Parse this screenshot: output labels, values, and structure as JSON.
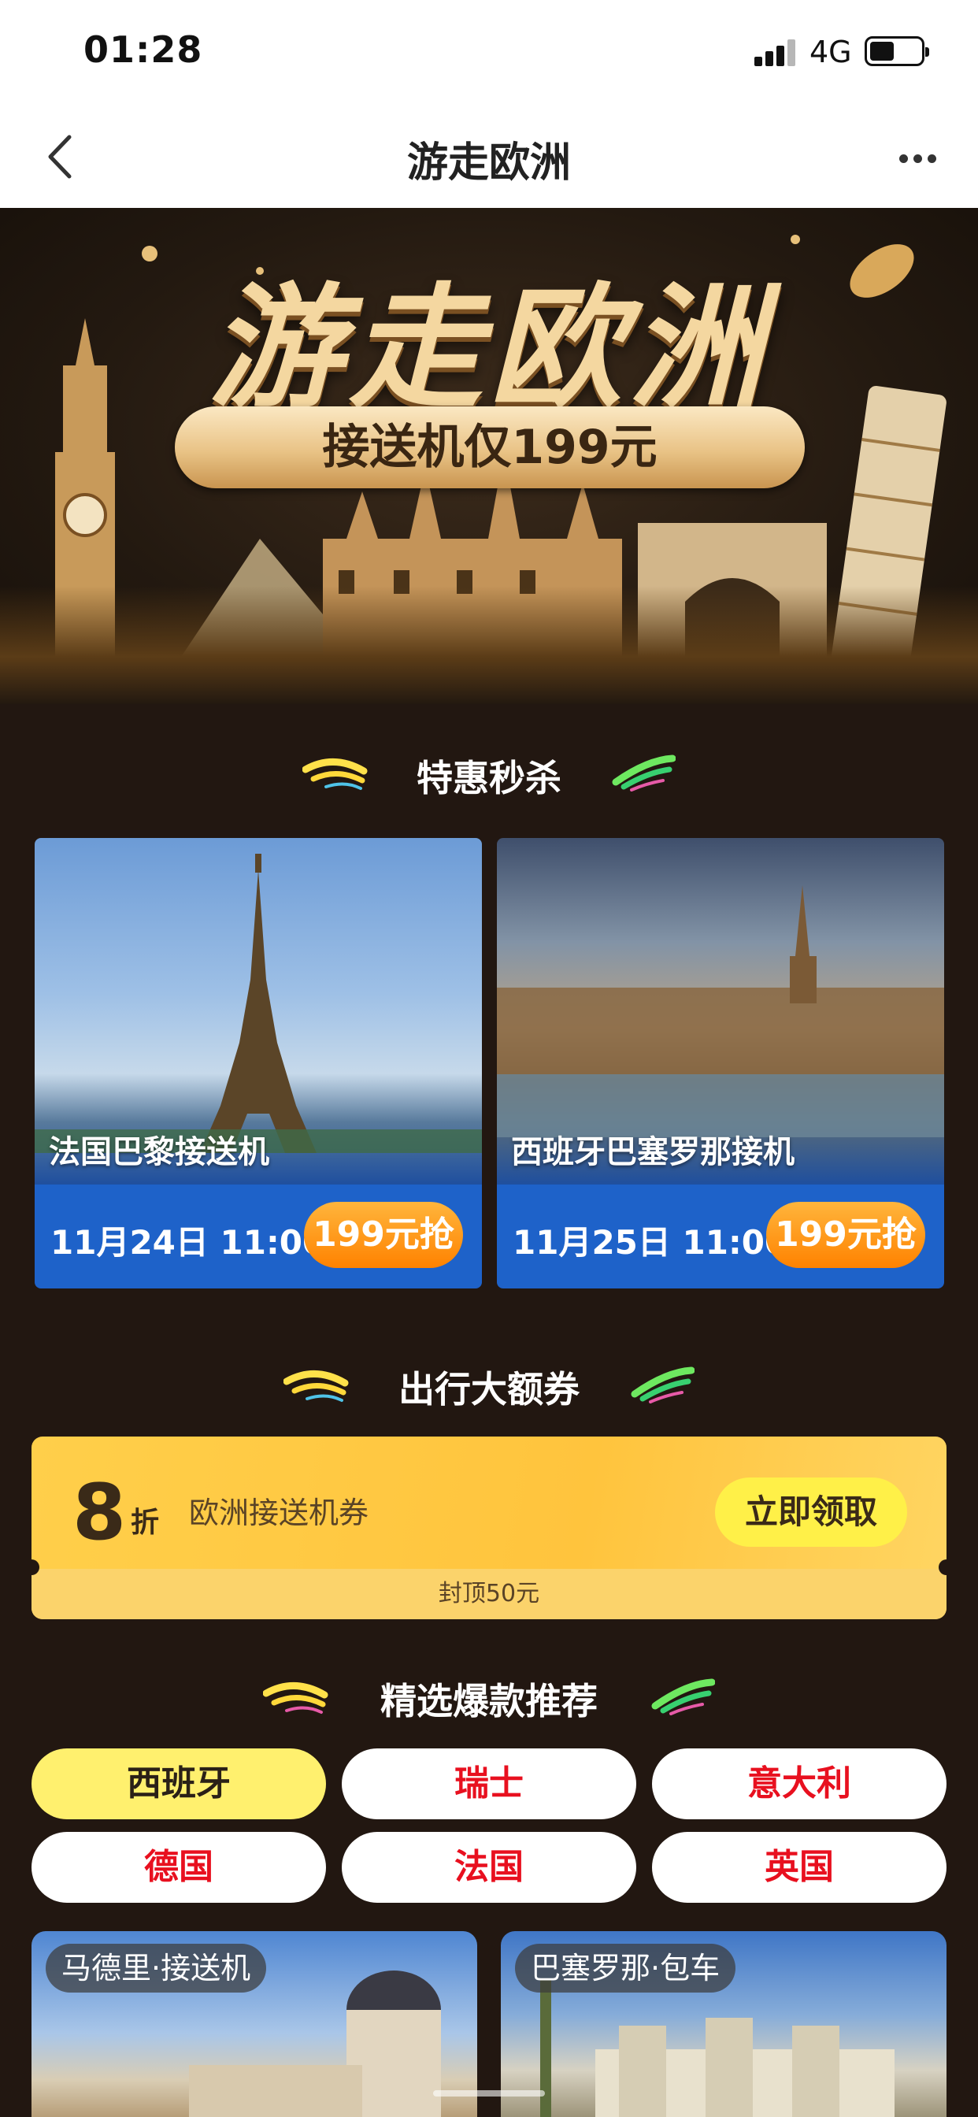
{
  "status_bar": {
    "time": "01:28",
    "network": "4G"
  },
  "nav": {
    "title": "游走欧洲"
  },
  "banner": {
    "title": "游走欧洲",
    "subtitle": "接送机仅199元"
  },
  "flash_sale": {
    "title": "特惠秒杀",
    "items": [
      {
        "label": "法国巴黎接送机",
        "date": "11月24日 11:00",
        "price_btn": "199元抢"
      },
      {
        "label": "西班牙巴塞罗那接机",
        "date": "11月25日 11:00",
        "price_btn": "199元抢"
      }
    ]
  },
  "coupon_section": {
    "title": "出行大额券",
    "coupon": {
      "discount": "8",
      "unit": "折",
      "name": "欧洲接送机券",
      "cap": "封顶50元",
      "claim_btn": "立即领取"
    }
  },
  "recommend": {
    "title": "精选爆款推荐",
    "countries": [
      "西班牙",
      "瑞士",
      "意大利",
      "德国",
      "法国",
      "英国"
    ],
    "active_country": "西班牙",
    "items": [
      {
        "tag": "马德里·接送机"
      },
      {
        "tag": "巴塞罗那·包车"
      }
    ]
  },
  "colors": {
    "page_bg": "#221711",
    "card_bar": "#1e62c9",
    "price_btn": "#ff8f12",
    "coupon": "#ffc43d",
    "chip_active": "#fff06e",
    "chip_text": "#e8101f"
  }
}
